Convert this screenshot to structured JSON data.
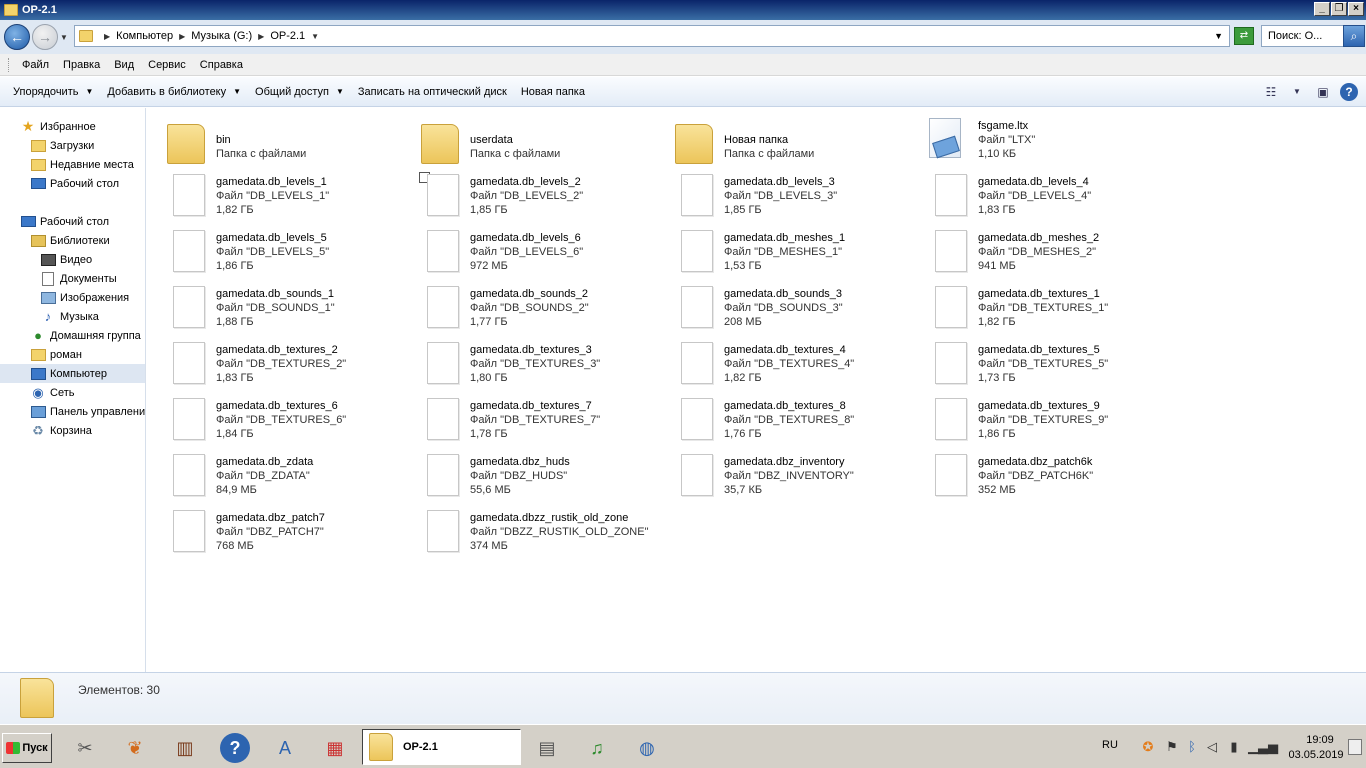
{
  "window": {
    "title": "OP-2.1"
  },
  "address": {
    "crumbs": [
      "Компьютер",
      "Музыка (G:)",
      "OP-2.1"
    ],
    "search_placeholder": "Поиск: О..."
  },
  "menu": [
    "Файл",
    "Правка",
    "Вид",
    "Сервис",
    "Справка"
  ],
  "commands": [
    {
      "label": "Упорядочить",
      "dropdown": true
    },
    {
      "label": "Добавить в библиотеку",
      "dropdown": true
    },
    {
      "label": "Общий доступ",
      "dropdown": true
    },
    {
      "label": "Записать на оптический диск",
      "dropdown": false
    },
    {
      "label": "Новая папка",
      "dropdown": false
    }
  ],
  "navpane": [
    {
      "label": "Избранное",
      "icon": "star-icon",
      "level": 0
    },
    {
      "label": "Загрузки",
      "icon": "downloads-folder-icon",
      "level": 1
    },
    {
      "label": "Недавние места",
      "icon": "recent-places-icon",
      "level": 1
    },
    {
      "label": "Рабочий стол",
      "icon": "desktop-icon",
      "level": 1
    },
    {
      "label": "Рабочий стол",
      "icon": "desktop-icon",
      "level": 0
    },
    {
      "label": "Библиотеки",
      "icon": "libraries-icon",
      "level": 1
    },
    {
      "label": "Видео",
      "icon": "video-icon",
      "level": 2
    },
    {
      "label": "Документы",
      "icon": "documents-icon",
      "level": 2
    },
    {
      "label": "Изображения",
      "icon": "pictures-icon",
      "level": 2
    },
    {
      "label": "Музыка",
      "icon": "music-icon",
      "level": 2
    },
    {
      "label": "Домашняя группа",
      "icon": "homegroup-icon",
      "level": 1
    },
    {
      "label": "роман",
      "icon": "user-icon",
      "level": 1
    },
    {
      "label": "Компьютер",
      "icon": "computer-icon",
      "level": 1,
      "selected": true
    },
    {
      "label": "Сеть",
      "icon": "network-icon",
      "level": 1
    },
    {
      "label": "Панель управлени",
      "icon": "control-panel-icon",
      "level": 1
    },
    {
      "label": "Корзина",
      "icon": "recycle-bin-icon",
      "level": 1
    }
  ],
  "items": [
    {
      "name": "bin",
      "type": "Папка с файлами",
      "size": "",
      "kind": "folder"
    },
    {
      "name": "userdata",
      "type": "Папка с файлами",
      "size": "",
      "kind": "folder"
    },
    {
      "name": "Новая папка",
      "type": "Папка с файлами",
      "size": "",
      "kind": "folder"
    },
    {
      "name": "fsgame.ltx",
      "type": "Файл \"LTX\"",
      "size": "1,10 КБ",
      "kind": "ltx"
    },
    {
      "name": "gamedata.db_levels_1",
      "type": "Файл \"DB_LEVELS_1\"",
      "size": "1,82 ГБ",
      "kind": "file"
    },
    {
      "name": "gamedata.db_levels_2",
      "type": "Файл \"DB_LEVELS_2\"",
      "size": "1,85 ГБ",
      "kind": "file"
    },
    {
      "name": "gamedata.db_levels_3",
      "type": "Файл \"DB_LEVELS_3\"",
      "size": "1,85 ГБ",
      "kind": "file"
    },
    {
      "name": "gamedata.db_levels_4",
      "type": "Файл \"DB_LEVELS_4\"",
      "size": "1,83 ГБ",
      "kind": "file"
    },
    {
      "name": "gamedata.db_levels_5",
      "type": "Файл \"DB_LEVELS_5\"",
      "size": "1,86 ГБ",
      "kind": "file"
    },
    {
      "name": "gamedata.db_levels_6",
      "type": "Файл \"DB_LEVELS_6\"",
      "size": "972 МБ",
      "kind": "file"
    },
    {
      "name": "gamedata.db_meshes_1",
      "type": "Файл \"DB_MESHES_1\"",
      "size": "1,53 ГБ",
      "kind": "file"
    },
    {
      "name": "gamedata.db_meshes_2",
      "type": "Файл \"DB_MESHES_2\"",
      "size": "941 МБ",
      "kind": "file"
    },
    {
      "name": "gamedata.db_sounds_1",
      "type": "Файл \"DB_SOUNDS_1\"",
      "size": "1,88 ГБ",
      "kind": "file"
    },
    {
      "name": "gamedata.db_sounds_2",
      "type": "Файл \"DB_SOUNDS_2\"",
      "size": "1,77 ГБ",
      "kind": "file"
    },
    {
      "name": "gamedata.db_sounds_3",
      "type": "Файл \"DB_SOUNDS_3\"",
      "size": "208 МБ",
      "kind": "file"
    },
    {
      "name": "gamedata.db_textures_1",
      "type": "Файл \"DB_TEXTURES_1\"",
      "size": "1,82 ГБ",
      "kind": "file"
    },
    {
      "name": "gamedata.db_textures_2",
      "type": "Файл \"DB_TEXTURES_2\"",
      "size": "1,83 ГБ",
      "kind": "file"
    },
    {
      "name": "gamedata.db_textures_3",
      "type": "Файл \"DB_TEXTURES_3\"",
      "size": "1,80 ГБ",
      "kind": "file"
    },
    {
      "name": "gamedata.db_textures_4",
      "type": "Файл \"DB_TEXTURES_4\"",
      "size": "1,82 ГБ",
      "kind": "file"
    },
    {
      "name": "gamedata.db_textures_5",
      "type": "Файл \"DB_TEXTURES_5\"",
      "size": "1,73 ГБ",
      "kind": "file"
    },
    {
      "name": "gamedata.db_textures_6",
      "type": "Файл \"DB_TEXTURES_6\"",
      "size": "1,84 ГБ",
      "kind": "file"
    },
    {
      "name": "gamedata.db_textures_7",
      "type": "Файл \"DB_TEXTURES_7\"",
      "size": "1,78 ГБ",
      "kind": "file"
    },
    {
      "name": "gamedata.db_textures_8",
      "type": "Файл \"DB_TEXTURES_8\"",
      "size": "1,76 ГБ",
      "kind": "file"
    },
    {
      "name": "gamedata.db_textures_9",
      "type": "Файл \"DB_TEXTURES_9\"",
      "size": "1,86 ГБ",
      "kind": "file"
    },
    {
      "name": "gamedata.db_zdata",
      "type": "Файл \"DB_ZDATA\"",
      "size": "84,9 МБ",
      "kind": "file"
    },
    {
      "name": "gamedata.dbz_huds",
      "type": "Файл \"DBZ_HUDS\"",
      "size": "55,6 МБ",
      "kind": "file"
    },
    {
      "name": "gamedata.dbz_inventory",
      "type": "Файл \"DBZ_INVENTORY\"",
      "size": "35,7 КБ",
      "kind": "file"
    },
    {
      "name": "gamedata.dbz_patch6k",
      "type": "Файл \"DBZ_PATCH6K\"",
      "size": "352 МБ",
      "kind": "file"
    },
    {
      "name": "gamedata.dbz_patch7",
      "type": "Файл \"DBZ_PATCH7\"",
      "size": "768 МБ",
      "kind": "file"
    },
    {
      "name": "gamedata.dbzz_rustik_old_zone",
      "type": "Файл \"DBZZ_RUSTIK_OLD_ZONE\"",
      "size": "374 МБ",
      "kind": "file"
    }
  ],
  "details": {
    "count_text": "Элементов: 30"
  },
  "taskbar": {
    "start_label": "Пуск",
    "active_window": "OP-2.1",
    "lang": "RU",
    "time": "19:09",
    "date": "03.05.2019"
  }
}
